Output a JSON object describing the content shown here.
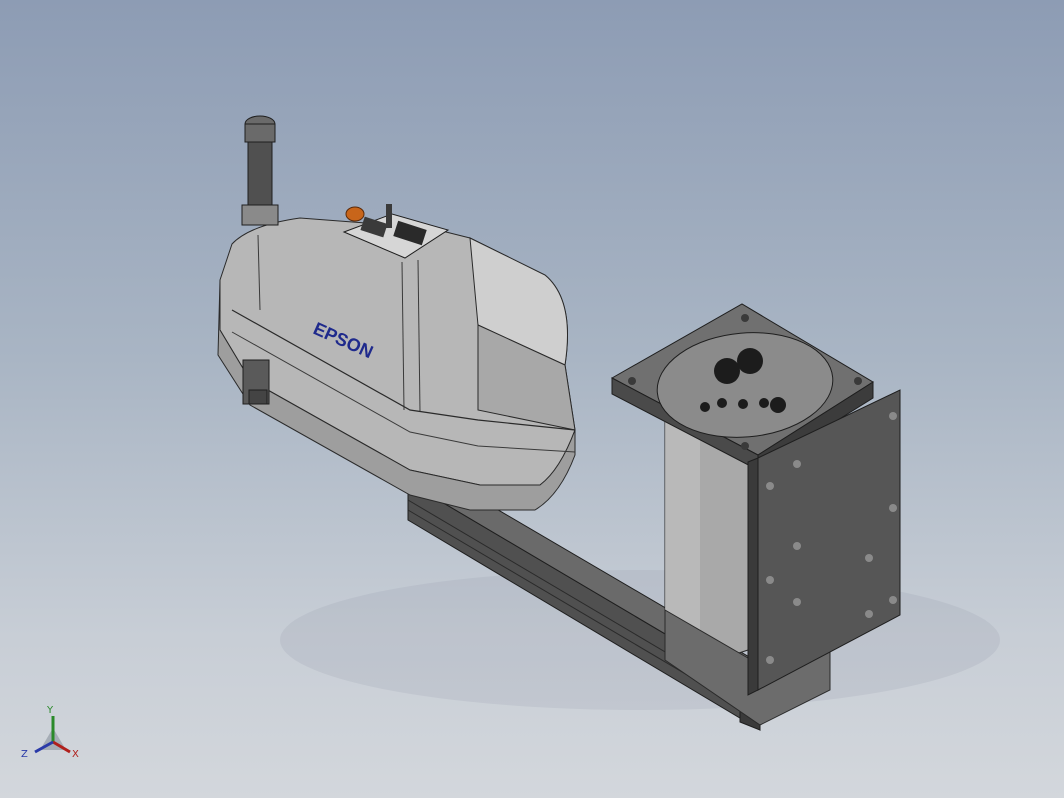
{
  "model": {
    "brand_label": "EPSON"
  },
  "triad": {
    "x_label": "X",
    "y_label": "Y",
    "z_label": "Z"
  },
  "colors": {
    "background_top": "#8d9cb4",
    "background_bottom": "#d3d7dc",
    "body_gray": "#b7b7b7",
    "dark_gray": "#5a5a5a",
    "brand_blue": "#1f2a8c",
    "indicator_orange": "#c8651a"
  }
}
